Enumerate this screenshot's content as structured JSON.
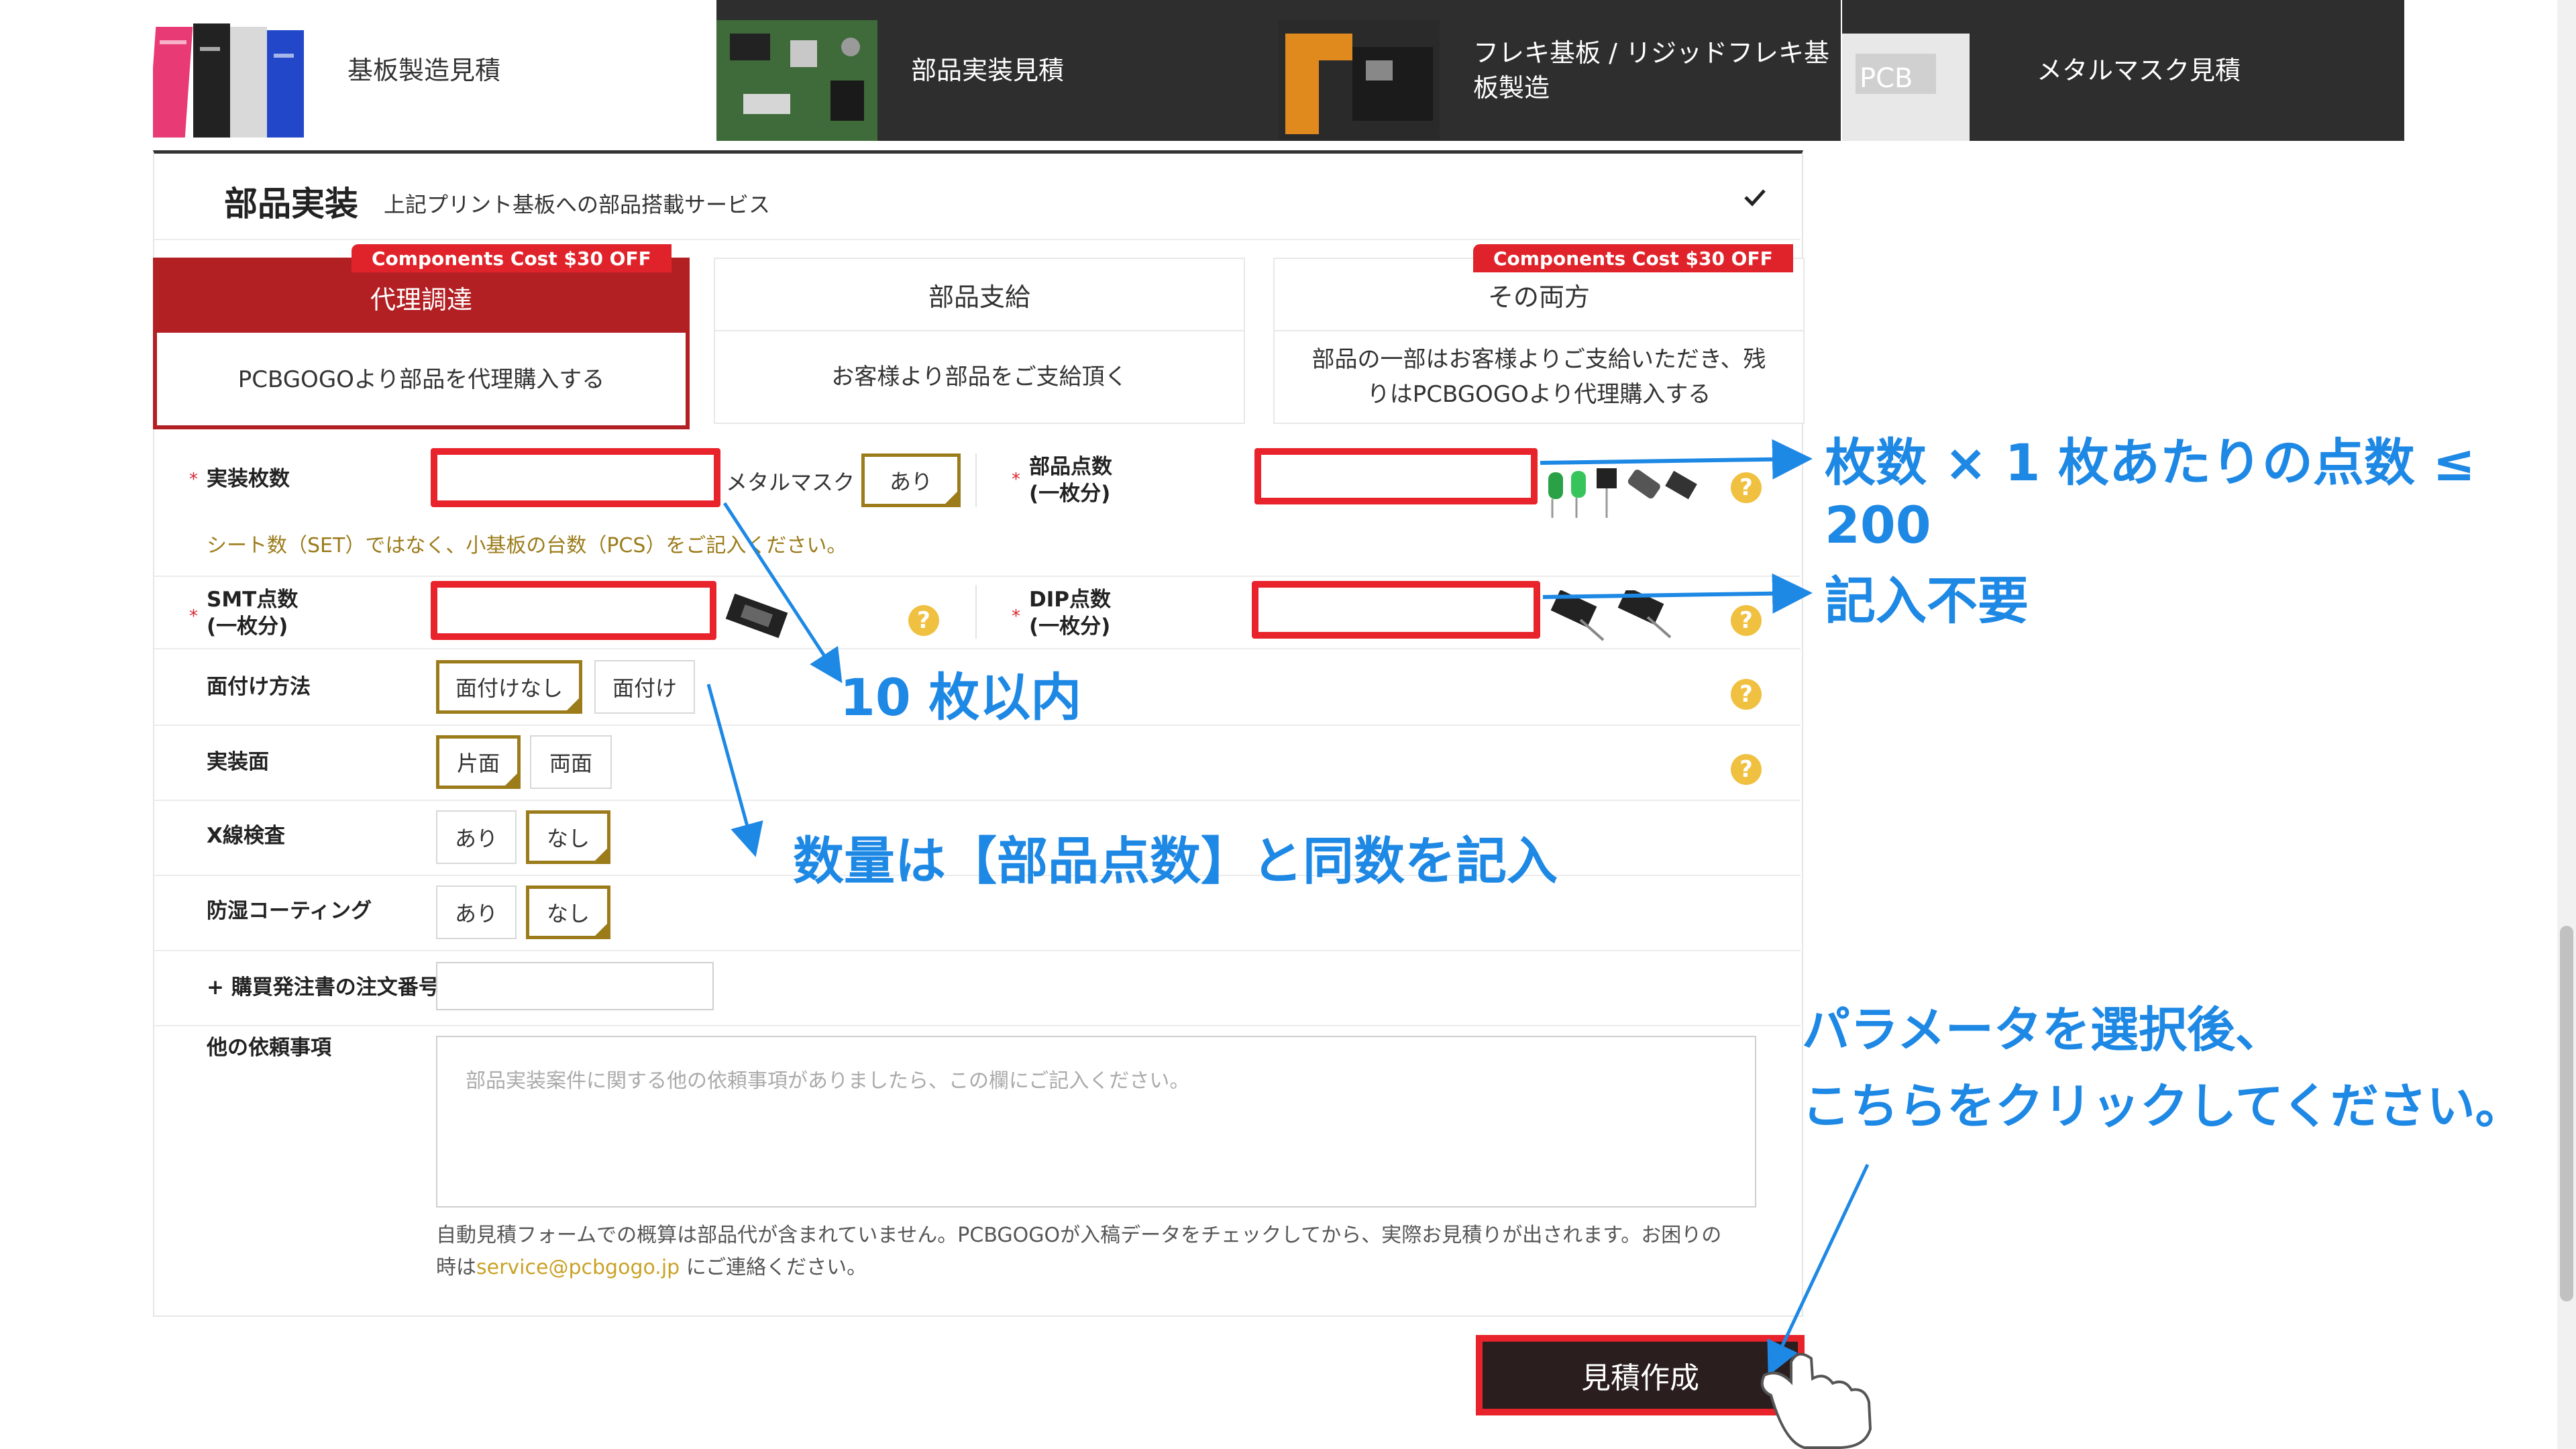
{
  "tabs": [
    {
      "label": "基板製造見積"
    },
    {
      "label": "部品実装見積"
    },
    {
      "label": "フレキ基板 / リジッドフレキ基板製造"
    },
    {
      "label": "メタルマスク見積"
    }
  ],
  "section": {
    "title": "部品実装",
    "subtitle": "上記プリント基板への部品搭載サービス",
    "check_icon": "check-icon"
  },
  "sourcing": {
    "promo": "Components Cost $30 OFF",
    "options": [
      {
        "title": "代理調達",
        "desc": "PCBGOGOより部品を代理購入する"
      },
      {
        "title": "部品支給",
        "desc": "お客様より部品をご支給頂く"
      },
      {
        "title": "その両方",
        "desc": "部品の一部はお客様よりご支給いただき、残りはPCBGOGOより代理購入する"
      }
    ]
  },
  "form": {
    "required_mark": "*",
    "mount_qty_label": "実装枚数",
    "metal_mask_label": "メタルマスク",
    "metal_mask_value": "あり",
    "parts_count_label": "部品点数\n(一枚分)",
    "pcs_note": "シート数（SET）ではなく、小基板の台数（PCS）をご記入ください。",
    "smt_label": "SMT点数\n(一枚分)",
    "dip_label": "DIP点数\n(一枚分)",
    "panel_label": "面付け方法",
    "panel_opts": [
      "面付けなし",
      "面付け"
    ],
    "side_label": "実装面",
    "side_opts": [
      "片面",
      "両面"
    ],
    "xray_label": "X線検査",
    "xray_opts": [
      "あり",
      "なし"
    ],
    "coating_label": "防湿コーティング",
    "coating_opts": [
      "あり",
      "なし"
    ],
    "po_label": "+ 購買発注書の注文番号",
    "other_label": "他の依頼事項",
    "other_placeholder": "部品実装案件に関する他の依頼事項がありましたら、この欄にご記入ください。",
    "footer_note_1": "自動見積フォームでの概算は部品代が含まれていません。PCBGOGOが入稿データをチェックしてから、実際お見積りが出されます。お困りの",
    "footer_note_2a": "時は",
    "footer_email": "service@pcbgogo.jp",
    "footer_note_2b": " にご連絡ください。",
    "help_glyph": "?"
  },
  "annotations": {
    "a1": "枚数 × 1 枚あたりの点数 ≤ 200",
    "a2": "記入不要",
    "a3": "10 枚以内",
    "a4": "数量は【部品点数】と同数を記入",
    "a5_line1": "パラメータを選択後、",
    "a5_line2": "こちらをクリックしてください。"
  },
  "quote_button": "見積作成",
  "colors": {
    "accent_red": "#e8232b",
    "selected_red": "#b32024",
    "gold": "#9b7b1a",
    "annot_blue": "#1e88e5",
    "dark_tab": "#2e2e2e"
  }
}
